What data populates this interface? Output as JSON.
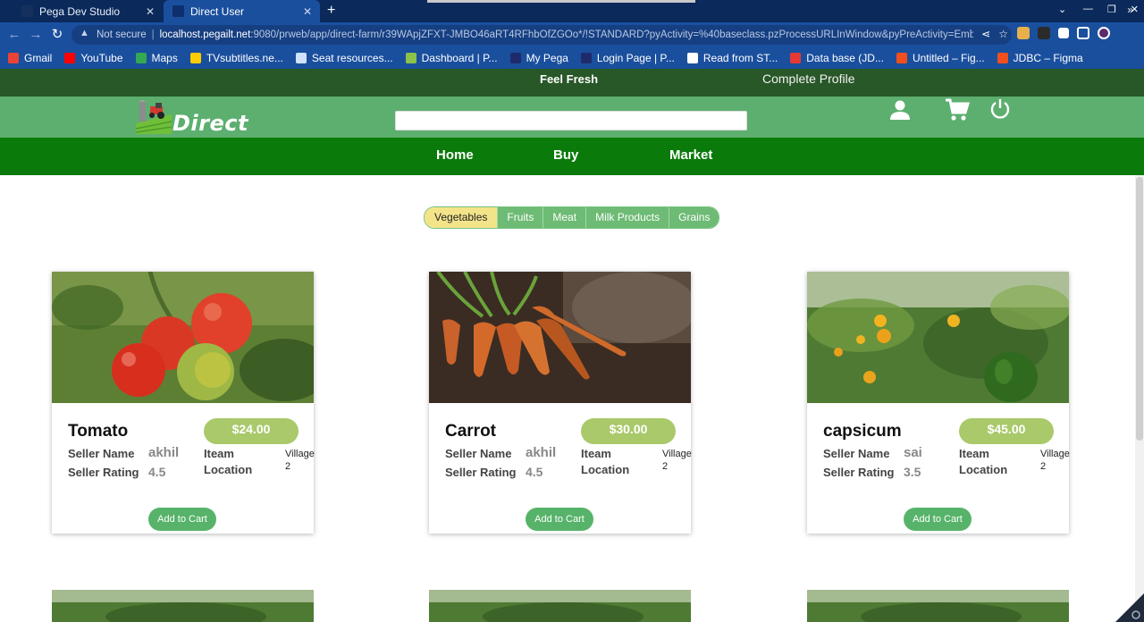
{
  "browser": {
    "tabs": [
      {
        "title": "Pega Dev Studio",
        "active": false
      },
      {
        "title": "Direct User",
        "active": true
      }
    ],
    "address": {
      "security": "Not secure",
      "host": "localhost.pegailt.net",
      "path": ":9080/prweb/app/direct-farm/r39WApjZFXT-JMBO46aRT4RFhbOfZGOo*/!STANDARD?pyActivity=%40baseclass.pzProcessURLInWindow&pyPreActivity=Embed-PortalLayout.Re..."
    },
    "bookmarks": [
      {
        "label": "Gmail",
        "icon": "gmail-icon",
        "color": "#ea4335"
      },
      {
        "label": "YouTube",
        "icon": "youtube-icon",
        "color": "#ff0000"
      },
      {
        "label": "Maps",
        "icon": "maps-icon",
        "color": "#34a853"
      },
      {
        "label": "TVsubtitles.ne...",
        "icon": "tv-icon",
        "color": "#ffcc00"
      },
      {
        "label": "Seat resources...",
        "icon": "seat-icon",
        "color": "#cfe3ff"
      },
      {
        "label": "Dashboard | P...",
        "icon": "dashboard-icon",
        "color": "#8bc34a"
      },
      {
        "label": "My Pega",
        "icon": "pega-icon",
        "color": "#1f2a6b"
      },
      {
        "label": "Login Page | P...",
        "icon": "login-icon",
        "color": "#1f2a6b"
      },
      {
        "label": "Read from ST...",
        "icon": "read-icon",
        "color": "#ffffff"
      },
      {
        "label": "Data base (JD...",
        "icon": "database-icon",
        "color": "#e53935"
      },
      {
        "label": "Untitled – Fig...",
        "icon": "figma-icon",
        "color": "#f24e1e"
      },
      {
        "label": "JDBC – Figma",
        "icon": "figma-icon",
        "color": "#f24e1e"
      }
    ]
  },
  "app": {
    "tagline": "Feel Fresh",
    "complete_profile": "Complete Profile",
    "brand": "Direct",
    "search_placeholder": "",
    "nav": [
      "Home",
      "Buy",
      "Market"
    ],
    "categories": [
      "Vegetables",
      "Fruits",
      "Meat",
      "Milk Products",
      "Grains"
    ],
    "active_category": "Vegetables",
    "labels": {
      "seller_name": "Seller Name",
      "seller_rating": "Seller Rating",
      "item_location_1": "Iteam",
      "item_location_2": "Location",
      "add_to_cart": "Add to Cart"
    },
    "products": [
      {
        "name": "Tomato",
        "price": "$24.00",
        "seller": "akhil",
        "rating": "4.5",
        "location_1": "Village",
        "location_2": "2"
      },
      {
        "name": "Carrot",
        "price": "$30.00",
        "seller": "akhil",
        "rating": "4.5",
        "location_1": "Village",
        "location_2": "2"
      },
      {
        "name": "capsicum",
        "price": "$45.00",
        "seller": "sai",
        "rating": "3.5",
        "location_1": "Village",
        "location_2": "2"
      }
    ]
  },
  "colors": {
    "top_strip": "#285728",
    "header": "#5daf6f",
    "nav": "#0a7a0a",
    "price_pill": "#a9c96a",
    "cart_button": "#58b36a",
    "active_category": "#f3e48a"
  }
}
